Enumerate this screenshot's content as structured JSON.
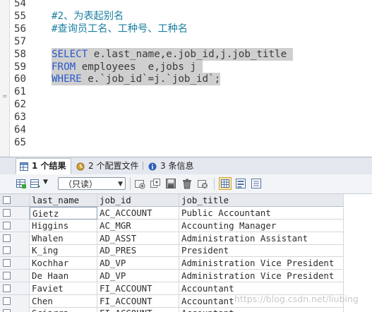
{
  "editor": {
    "lines": [
      {
        "num": "54",
        "parts": []
      },
      {
        "num": "55",
        "parts": [
          {
            "t": "#2、为表起别名",
            "c": "comment"
          }
        ]
      },
      {
        "num": "56",
        "parts": [
          {
            "t": "#查询员工名、工种号、工种名",
            "c": "comment"
          }
        ]
      },
      {
        "num": "57",
        "parts": []
      },
      {
        "num": "58",
        "parts": [
          {
            "t": "SELECT",
            "c": "kw"
          },
          {
            "t": " e.last_name,e.job_id,j.job_title ",
            "c": "text"
          }
        ],
        "selected": true
      },
      {
        "num": "59",
        "parts": [
          {
            "t": "FROM",
            "c": "kw"
          },
          {
            "t": " employees  e,jobs j ",
            "c": "text"
          }
        ],
        "selected": true
      },
      {
        "num": "60",
        "parts": [
          {
            "t": "WHERE",
            "c": "kw"
          },
          {
            "t": " e.`job_id`=j.`job_id`;",
            "c": "text"
          }
        ],
        "selected": true
      },
      {
        "num": "61",
        "parts": []
      },
      {
        "num": "62",
        "parts": []
      },
      {
        "num": "63",
        "parts": []
      },
      {
        "num": "64",
        "parts": []
      },
      {
        "num": "65",
        "parts": []
      }
    ]
  },
  "tabs": [
    {
      "label": "1 个结果",
      "icon": "result-grid-icon",
      "active": true
    },
    {
      "label": "2 个配置文件",
      "icon": "profile-icon",
      "active": false
    },
    {
      "label": "3 条信息",
      "icon": "info-icon",
      "active": false
    }
  ],
  "toolbar": {
    "mode_value": "（只读）"
  },
  "grid": {
    "columns": [
      "last_name",
      "job_id",
      "job_title"
    ],
    "rows": [
      [
        "Gietz",
        "AC_ACCOUNT",
        "Public Accountant"
      ],
      [
        "Higgins",
        "AC_MGR",
        "Accounting Manager"
      ],
      [
        "Whalen",
        "AD_ASST",
        "Administration Assistant"
      ],
      [
        "K_ing",
        "AD_PRES",
        "President"
      ],
      [
        "Kochhar",
        "AD_VP",
        "Administration Vice President"
      ],
      [
        "De Haan",
        "AD_VP",
        "Administration Vice President"
      ],
      [
        "Faviet",
        "FI_ACCOUNT",
        "Accountant"
      ],
      [
        "Chen",
        "FI_ACCOUNT",
        "Accountant"
      ],
      [
        "Sciarra",
        "FI_ACCOUNT",
        "Accountant"
      ]
    ]
  },
  "watermark": "https://blog.csdn.net/liubing",
  "colors": {
    "keyword": "#2b59c9",
    "comment": "#1b7fa0",
    "selection": "#cfcfcf",
    "tab_bar": "#e4e8ee"
  }
}
